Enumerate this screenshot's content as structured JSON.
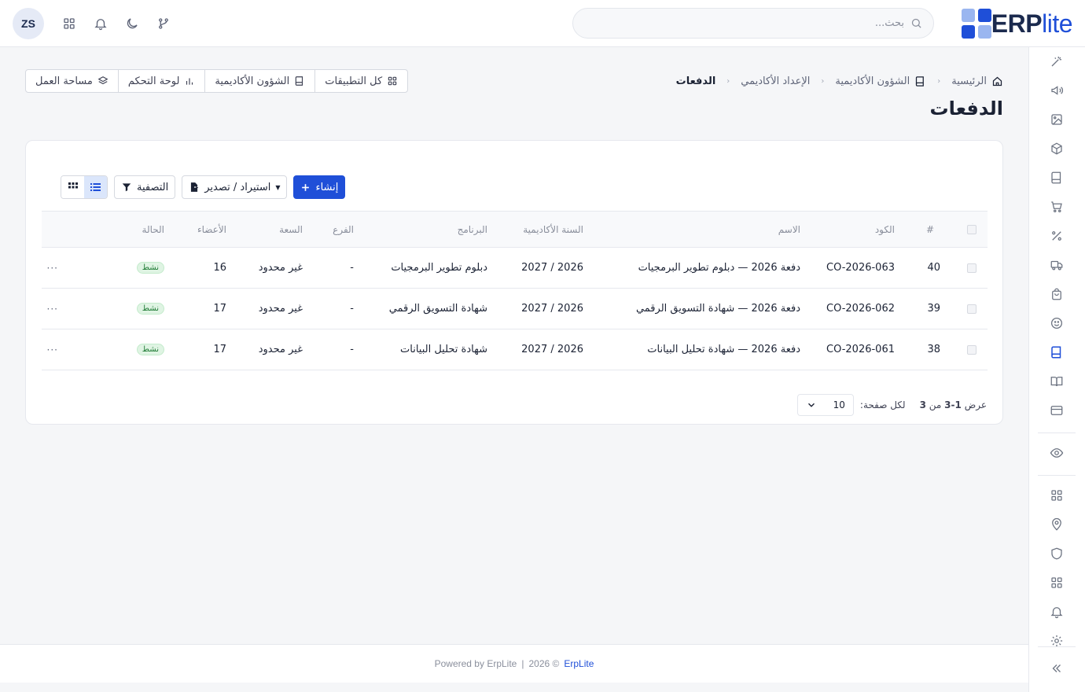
{
  "brand": {
    "name_main": "ERP",
    "name_accent": "lite",
    "logo_colors": [
      "#1f4fd8",
      "#9ab6f0",
      "#9ab6f0",
      "#1f4fd8"
    ]
  },
  "search": {
    "placeholder": "بحث..."
  },
  "user": {
    "initials": "ZS"
  },
  "topbar_icons": [
    "git-branch-icon",
    "moon-icon",
    "bell-icon",
    "apps-grid-icon"
  ],
  "breadcrumb": [
    {
      "label": "الرئيسية",
      "icon": "home-icon"
    },
    {
      "label": "الشؤون الأكاديمية",
      "icon": "book-icon"
    },
    {
      "label": "الإعداد الأكاديمي"
    },
    {
      "label": "الدفعات"
    }
  ],
  "page": {
    "title": "الدفعات"
  },
  "quick_links": [
    {
      "label": "كل التطبيقات",
      "icon": "apps-grid-icon"
    },
    {
      "label": "الشؤون الأكاديمية",
      "icon": "book-icon"
    },
    {
      "label": "لوحة التحكم",
      "icon": "bar-chart-icon"
    },
    {
      "label": "مساحة العمل",
      "icon": "layers-icon"
    }
  ],
  "toolbar": {
    "create_label": "إنشاء",
    "import_export_label": "استيراد / تصدير",
    "filter_label": "التصفية"
  },
  "table": {
    "headers": {
      "index": "#",
      "code": "الكود",
      "name": "الاسم",
      "year": "السنة الأكاديمية",
      "program": "البرنامج",
      "branch": "الفرع",
      "capacity": "السعة",
      "members": "الأعضاء",
      "status": "الحالة"
    },
    "rows": [
      {
        "index": "40",
        "code": "CO-2026-063",
        "name": "دفعة 2026 — دبلوم تطوير البرمجيات",
        "year": "2026 / 2027",
        "program": "دبلوم تطوير البرمجيات",
        "branch": "-",
        "capacity": "غير محدود",
        "members": "16",
        "status": "نشط",
        "more": "···"
      },
      {
        "index": "39",
        "code": "CO-2026-062",
        "name": "دفعة 2026 — شهادة التسويق الرقمي",
        "year": "2026 / 2027",
        "program": "شهادة التسويق الرقمي",
        "branch": "-",
        "capacity": "غير محدود",
        "members": "17",
        "status": "نشط",
        "more": "···"
      },
      {
        "index": "38",
        "code": "CO-2026-061",
        "name": "دفعة 2026 — شهادة تحليل البيانات",
        "year": "2026 / 2027",
        "program": "شهادة تحليل البيانات",
        "branch": "-",
        "capacity": "غير محدود",
        "members": "17",
        "status": "نشط",
        "more": "···"
      }
    ]
  },
  "pagination": {
    "showing_label": "عرض",
    "range": "1-3",
    "of_label": "من",
    "total": "3",
    "per_page_label": "لكل صفحة:",
    "per_page": "10"
  },
  "sidebar_icons": [
    "wand-icon",
    "megaphone-icon",
    "image-icon",
    "box-icon",
    "book-icon",
    "cart-icon",
    "percent-icon",
    "truck-icon",
    "shopping-bag-icon",
    "smile-icon",
    "book-active-icon",
    "book-open-icon",
    "credit-card-icon",
    "eye-icon",
    "apps-grid-icon",
    "map-pin-icon",
    "shield-icon",
    "apps-grid-icon",
    "bell-icon",
    "gear-icon",
    "collapse-icon"
  ],
  "footer": {
    "powered": "Powered by ErpLite",
    "divider": "|",
    "year": "2026 ©",
    "link": "ErpLite"
  }
}
